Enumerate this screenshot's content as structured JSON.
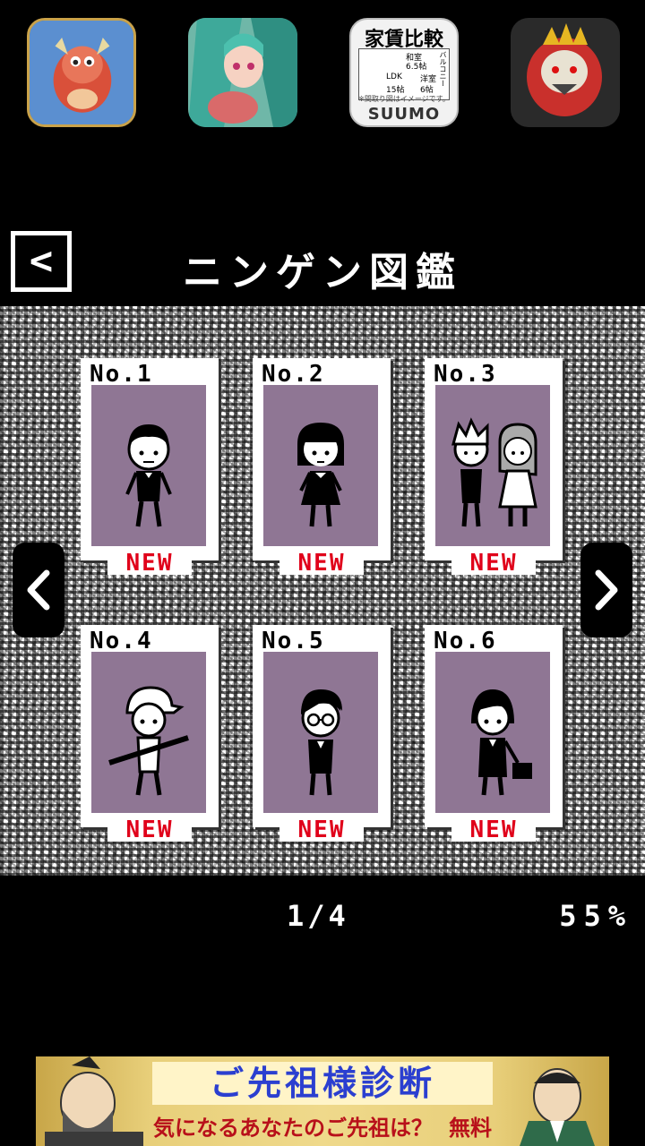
{
  "ad_icons": [
    {
      "name": "dragon-icon"
    },
    {
      "name": "anime-girl-icon"
    },
    {
      "name": "suumo-icon",
      "title": "家賃比較",
      "brand": "SUUMO",
      "note": "※間取り図はイメージです。",
      "plan": [
        "和室",
        "6.5帖",
        "LDK",
        "15帖",
        "洋室",
        "6帖",
        "バルコニー"
      ]
    },
    {
      "name": "monster-icon"
    }
  ],
  "header": {
    "back_label": "<",
    "title": "ニンゲン図鑑"
  },
  "cards": [
    {
      "no": "No.1",
      "badge": "NEW",
      "character": "boy"
    },
    {
      "no": "No.2",
      "badge": "NEW",
      "character": "girl"
    },
    {
      "no": "No.3",
      "badge": "NEW",
      "character": "couple"
    },
    {
      "no": "No.4",
      "badge": "NEW",
      "character": "baseball-player"
    },
    {
      "no": "No.5",
      "badge": "NEW",
      "character": "glasses-man"
    },
    {
      "no": "No.6",
      "badge": "NEW",
      "character": "office-lady"
    }
  ],
  "pager": {
    "current": "1/4"
  },
  "completion": "55%",
  "banner": {
    "title": "ご先祖様診断",
    "subtitle": "気になるあなたのご先祖は？",
    "free": "無料"
  },
  "colors": {
    "portrait_bg": "#8f7694",
    "new_red": "#e0001a",
    "banner_blue": "#2b3fd0"
  }
}
